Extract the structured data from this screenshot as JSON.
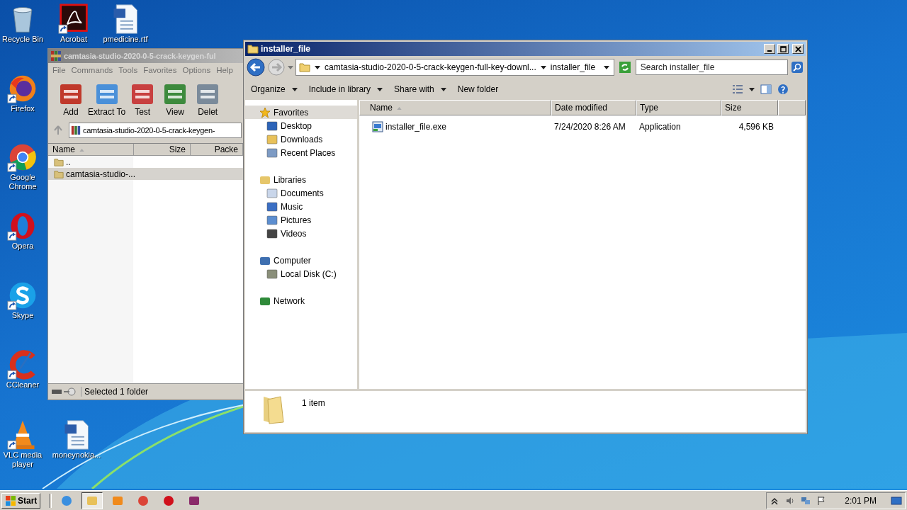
{
  "desktop": {
    "icons": [
      {
        "label": "Recycle Bin",
        "kind": "recycle",
        "shortcut": false
      },
      {
        "label": "Acrobat",
        "kind": "pdf",
        "shortcut": true
      },
      {
        "label": "pmedicine.rtf",
        "kind": "word",
        "shortcut": false
      },
      {
        "label": "Firefox",
        "kind": "firefox",
        "shortcut": true
      },
      {
        "label": "Google Chrome",
        "kind": "chrome",
        "shortcut": true
      },
      {
        "label": "Opera",
        "kind": "opera",
        "shortcut": true
      },
      {
        "label": "Skype",
        "kind": "skype",
        "shortcut": true
      },
      {
        "label": "CCleaner",
        "kind": "ccleaner",
        "shortcut": true
      },
      {
        "label": "VLC media player",
        "kind": "vlc",
        "shortcut": true
      },
      {
        "label": "moneynokia...",
        "kind": "word",
        "shortcut": false
      }
    ]
  },
  "archive_window": {
    "title": "camtasia-studio-2020-0-5-crack-keygen-ful",
    "menu": [
      "File",
      "Commands",
      "Tools",
      "Favorites",
      "Options",
      "Help"
    ],
    "tools": [
      {
        "label": "Add",
        "kind": "add"
      },
      {
        "label": "Extract To",
        "kind": "extract"
      },
      {
        "label": "Test",
        "kind": "test"
      },
      {
        "label": "View",
        "kind": "view"
      },
      {
        "label": "Delet",
        "kind": "delete"
      }
    ],
    "path": "camtasia-studio-2020-0-5-crack-keygen-",
    "columns": [
      "Name",
      "Size",
      "Packe"
    ],
    "rows": [
      {
        "name": "..",
        "selected": false
      },
      {
        "name": "camtasia-studio-...",
        "selected": true
      }
    ],
    "status": "Selected 1 folder"
  },
  "explorer": {
    "title": "installer_file",
    "breadcrumb": [
      "camtasia-studio-2020-0-5-crack-keygen-full-key-downl...",
      "installer_file"
    ],
    "search": {
      "placeholder": "Search installer_file"
    },
    "commands": [
      {
        "label": "Organize",
        "dropdown": true
      },
      {
        "label": "Include in library",
        "dropdown": true
      },
      {
        "label": "Share with",
        "dropdown": true
      },
      {
        "label": "New folder",
        "dropdown": false
      }
    ],
    "nav": [
      {
        "label": "Favorites",
        "kind": "star",
        "selected": true,
        "children": [
          {
            "label": "Desktop",
            "kind": "desktop",
            "selected": false
          },
          {
            "label": "Downloads",
            "kind": "downloads",
            "selected": false
          },
          {
            "label": "Recent Places",
            "kind": "recent",
            "selected": false
          }
        ]
      },
      {
        "label": "Libraries",
        "kind": "library",
        "selected": false,
        "children": [
          {
            "label": "Documents",
            "kind": "documents",
            "selected": false
          },
          {
            "label": "Music",
            "kind": "music",
            "selected": false
          },
          {
            "label": "Pictures",
            "kind": "pictures",
            "selected": false
          },
          {
            "label": "Videos",
            "kind": "videos",
            "selected": false
          }
        ]
      },
      {
        "label": "Computer",
        "kind": "computer",
        "selected": false,
        "children": [
          {
            "label": "Local Disk (C:)",
            "kind": "disk",
            "selected": false
          }
        ]
      },
      {
        "label": "Network",
        "kind": "network",
        "selected": false
      }
    ],
    "columns": [
      {
        "label": "Name",
        "sorted": true
      },
      {
        "label": "Date modified",
        "sorted": false
      },
      {
        "label": "Type",
        "sorted": false
      },
      {
        "label": "Size",
        "sorted": false
      }
    ],
    "files": [
      {
        "name": "installer_file.exe",
        "date": "7/24/2020 8:26 AM",
        "type": "Application",
        "size": "4,596 KB",
        "selected": false
      }
    ],
    "details": "1 item"
  },
  "taskbar": {
    "start": "Start",
    "items": [
      {
        "kind": "ie",
        "selected": false
      },
      {
        "kind": "explorer",
        "selected": true
      },
      {
        "kind": "media",
        "selected": false
      },
      {
        "kind": "chrome",
        "selected": false
      },
      {
        "kind": "opera",
        "selected": false
      },
      {
        "kind": "winrar",
        "selected": false
      }
    ],
    "clock": "2:01 PM"
  }
}
